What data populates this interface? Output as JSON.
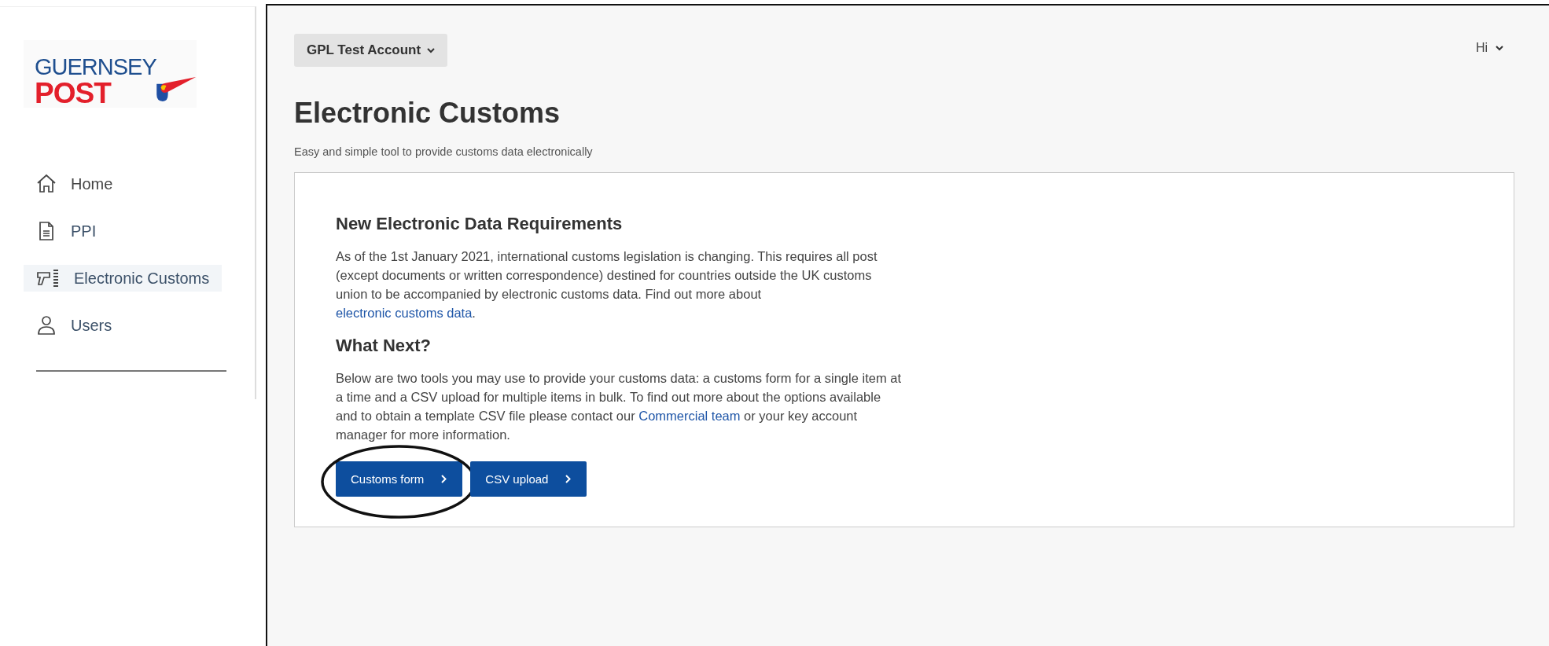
{
  "logo": {
    "line_1": "GUERNSEY",
    "line_2": "POST"
  },
  "nav": [
    {
      "label": "Home",
      "kind": "home",
      "selected": false
    },
    {
      "label": "PPI",
      "kind": "document",
      "selected": false
    },
    {
      "label": "Electronic Customs",
      "kind": "scanner",
      "selected": true
    },
    {
      "label": "Users",
      "kind": "user",
      "selected": false
    }
  ],
  "account_menu": {
    "label": "GPL Test Account"
  },
  "user_menu": {
    "label": "Hi"
  },
  "page": {
    "title": "Electronic Customs",
    "subtitle": "Easy and simple tool to provide customs data electronically"
  },
  "card": {
    "sections": [
      {
        "heading": "New Electronic Data Requirements",
        "paragraph": [
          {
            "kind": "text",
            "text": "As of the 1st January 2021, international customs legislation is changing. This requires all post (except documents or written correspondence) destined for countries outside the UK customs union to be accompanied by electronic customs data. Find out more about "
          },
          {
            "kind": "link",
            "text": "electronic customs data"
          },
          {
            "kind": "text",
            "text": "."
          }
        ]
      },
      {
        "heading": "What Next?",
        "paragraph": [
          {
            "kind": "text",
            "text": "Below are two tools you may use to provide your customs data: a customs form for a single item at a time and a CSV upload for multiple items in bulk. To find out more about the options available and to obtain a template CSV file please contact our "
          },
          {
            "kind": "link",
            "text": "Commercial team"
          },
          {
            "kind": "text",
            "text": " or your key account manager for more information."
          }
        ]
      }
    ],
    "buttons": [
      {
        "label": "Customs form",
        "circled": true
      },
      {
        "label": "CSV upload",
        "circled": false
      }
    ]
  }
}
